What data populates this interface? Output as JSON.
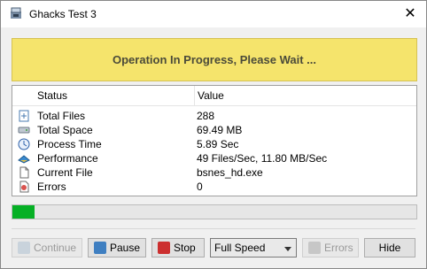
{
  "window": {
    "title": "Ghacks Test 3"
  },
  "banner": {
    "text": "Operation In Progress, Please Wait ..."
  },
  "table": {
    "headers": {
      "status": "Status",
      "value": "Value"
    },
    "rows": [
      {
        "label": "Total Files",
        "value": "288",
        "icon": "files-icon"
      },
      {
        "label": "Total Space",
        "value": "69.49 MB",
        "icon": "disk-icon"
      },
      {
        "label": "Process Time",
        "value": "5.89 Sec",
        "icon": "clock-icon"
      },
      {
        "label": "Performance",
        "value": "49 Files/Sec, 11.80 MB/Sec",
        "icon": "speed-icon"
      },
      {
        "label": "Current File",
        "value": "bsnes_hd.exe",
        "icon": "file-icon"
      },
      {
        "label": "Errors",
        "value": "0",
        "icon": "error-icon"
      }
    ]
  },
  "progress": {
    "fraction": 0.055
  },
  "controls": {
    "continue_label": "Continue",
    "pause_label": "Pause",
    "stop_label": "Stop",
    "speed_value": "Full Speed",
    "errors_label": "Errors",
    "hide_label": "Hide"
  },
  "colors": {
    "banner_bg": "#f5e46c",
    "progress_fill": "#06b025"
  }
}
